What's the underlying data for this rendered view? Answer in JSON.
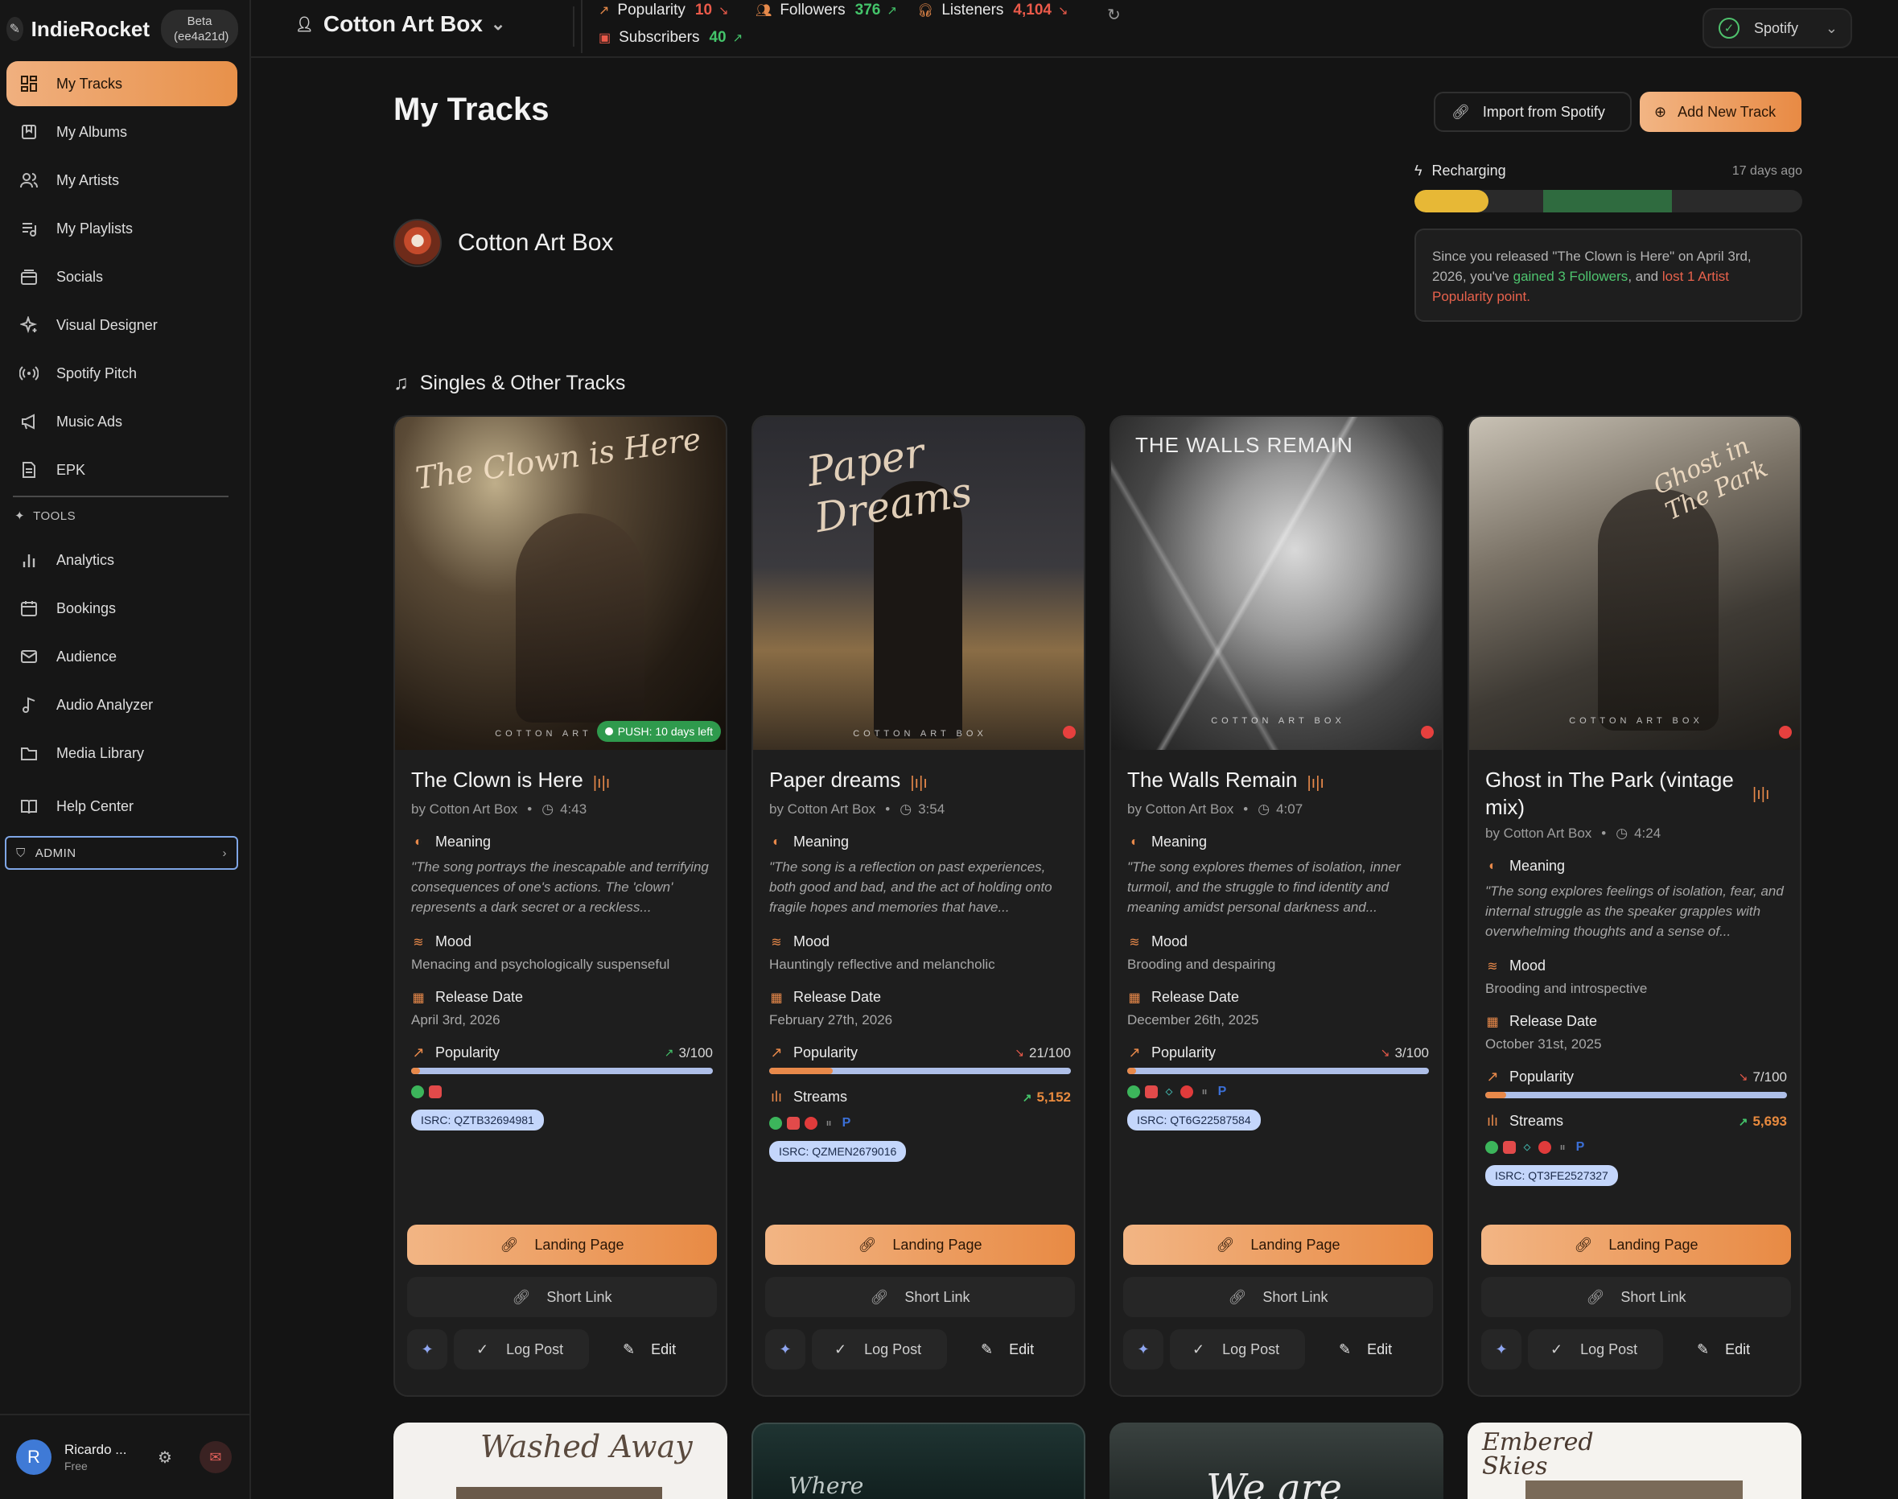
{
  "app": {
    "name": "IndieRocket",
    "badge": "Beta (ee4a21d)"
  },
  "sidebar": {
    "items": [
      {
        "label": "My Tracks",
        "icon": "grid-icon"
      },
      {
        "label": "My Albums",
        "icon": "album-icon"
      },
      {
        "label": "My Artists",
        "icon": "users-icon"
      },
      {
        "label": "My Playlists",
        "icon": "playlist-icon"
      },
      {
        "label": "Socials",
        "icon": "socials-icon"
      },
      {
        "label": "Visual Designer",
        "icon": "sparkle-icon"
      },
      {
        "label": "Spotify Pitch",
        "icon": "broadcast-icon"
      },
      {
        "label": "Music Ads",
        "icon": "megaphone-icon"
      },
      {
        "label": "EPK",
        "icon": "document-icon"
      }
    ],
    "tools_label": "TOOLS",
    "tools": [
      {
        "label": "Analytics",
        "icon": "bar-chart-icon"
      },
      {
        "label": "Bookings",
        "icon": "calendar-icon"
      },
      {
        "label": "Audience",
        "icon": "mail-icon"
      },
      {
        "label": "Audio Analyzer",
        "icon": "music-note-icon"
      },
      {
        "label": "Media Library",
        "icon": "folder-icon"
      }
    ],
    "help": "Help Center",
    "admin": "ADMIN",
    "user": {
      "initial": "R",
      "name": "Ricardo ...",
      "plan": "Free"
    }
  },
  "topbar": {
    "artist": "Cotton Art Box",
    "stats": {
      "popularity": {
        "label": "Popularity",
        "value": "10",
        "trend": "down"
      },
      "followers": {
        "label": "Followers",
        "value": "376",
        "trend": "up"
      },
      "listeners": {
        "label": "Listeners",
        "value": "4,104",
        "trend": "down"
      },
      "subscribers": {
        "label": "Subscribers",
        "value": "40",
        "trend": "up"
      }
    },
    "platform": "Spotify"
  },
  "header": {
    "title": "My Tracks",
    "import_label": "Import from Spotify",
    "add_label": "Add New Track",
    "artist_name": "Cotton Art Box"
  },
  "recharge": {
    "label": "Recharging",
    "ago": "17 days ago",
    "insight_pre": "Since you released \"The Clown is Here\" on April 3rd, 2026, you've ",
    "insight_gain": "gained 3 Followers",
    "insight_mid": ", and ",
    "insight_loss": "lost 1 Artist Popularity point",
    "insight_end": "."
  },
  "section": {
    "title": "Singles & Other Tracks"
  },
  "labels": {
    "meaning": "Meaning",
    "mood": "Mood",
    "release": "Release Date",
    "popularity": "Popularity",
    "streams": "Streams",
    "landing": "Landing Page",
    "short": "Short Link",
    "log": "Log Post",
    "edit": "Edit",
    "by": "by Cotton Art Box",
    "cover_brand": "COTTON ART BOX"
  },
  "tracks": [
    {
      "title": "The Clown is Here",
      "duration": "4:43",
      "meaning": "\"The song portrays the inescapable and terrifying consequences of one's actions. The 'clown' represents a dark secret or a reckless...",
      "mood": "Menacing and psychologically suspenseful",
      "release": "April 3rd, 2026",
      "popularity": "3/100",
      "popularity_pct": 3,
      "pop_trend": "up",
      "isrc": "ISRC: QZTB32694981",
      "push": "PUSH: 10 days left",
      "cover_text": "The Clown is Here"
    },
    {
      "title": "Paper dreams",
      "duration": "3:54",
      "meaning": "\"The song is a reflection on past experiences, both good and bad, and the act of holding onto fragile hopes and memories that have...",
      "mood": "Hauntingly reflective and melancholic",
      "release": "February 27th, 2026",
      "popularity": "21/100",
      "popularity_pct": 21,
      "pop_trend": "down",
      "streams": "5,152",
      "isrc": "ISRC: QZMEN2679016",
      "cover_text": "Paper Dreams"
    },
    {
      "title": "The Walls Remain",
      "duration": "4:07",
      "meaning": "\"The song explores themes of isolation, inner turmoil, and the struggle to find identity and meaning amidst personal darkness and...",
      "mood": "Brooding and despairing",
      "release": "December 26th, 2025",
      "popularity": "3/100",
      "popularity_pct": 3,
      "pop_trend": "down",
      "isrc": "ISRC: QT6G22587584",
      "cover_text": "THE WALLS REMAIN"
    },
    {
      "title": "Ghost in The Park (vintage mix)",
      "duration": "4:24",
      "meaning": "\"The song explores feelings of isolation, fear, and internal struggle as the speaker grapples with overwhelming thoughts and a sense of...",
      "mood": "Brooding and introspective",
      "release": "October 31st, 2025",
      "popularity": "7/100",
      "popularity_pct": 7,
      "pop_trend": "down",
      "streams": "5,693",
      "isrc": "ISRC: QT3FE2527327",
      "cover_text": "Ghost in The Park"
    }
  ],
  "next_row": [
    "Washed Away",
    "Where",
    "We are",
    "Embered Skies"
  ],
  "colors": {
    "accent": "#e8894a",
    "positive": "#44c46a",
    "negative": "#ea5a4a"
  }
}
